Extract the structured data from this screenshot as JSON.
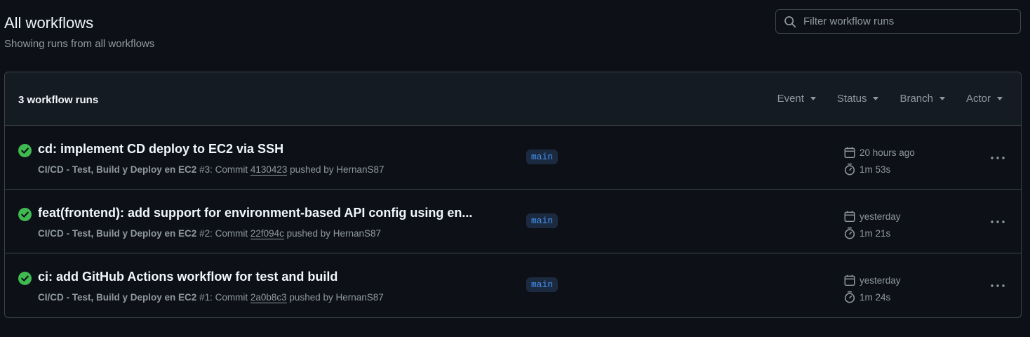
{
  "header": {
    "title": "All workflows",
    "subtitle": "Showing runs from all workflows"
  },
  "search": {
    "placeholder": "Filter workflow runs",
    "value": ""
  },
  "list": {
    "count_label": "3 workflow runs",
    "filters": [
      {
        "label": "Event"
      },
      {
        "label": "Status"
      },
      {
        "label": "Branch"
      },
      {
        "label": "Actor"
      }
    ]
  },
  "runs": [
    {
      "title": "cd: implement CD deploy to EC2 via SSH",
      "workflow": "CI/CD - Test, Build y Deploy en EC2",
      "run_number": "#3",
      "commit_prefix": ": Commit ",
      "sha": "4130423",
      "pushed_by": " pushed by HernanS87",
      "branch": "main",
      "when": "20 hours ago",
      "duration": "1m 53s",
      "status": "success"
    },
    {
      "title": "feat(frontend): add support for environment-based API config using en...",
      "workflow": "CI/CD - Test, Build y Deploy en EC2",
      "run_number": "#2",
      "commit_prefix": ": Commit ",
      "sha": "22f094c",
      "pushed_by": " pushed by HernanS87",
      "branch": "main",
      "when": "yesterday",
      "duration": "1m 21s",
      "status": "success"
    },
    {
      "title": "ci: add GitHub Actions workflow for test and build",
      "workflow": "CI/CD - Test, Build y Deploy en EC2",
      "run_number": "#1",
      "commit_prefix": ": Commit ",
      "sha": "2a0b8c3",
      "pushed_by": " pushed by HernanS87",
      "branch": "main",
      "when": "yesterday",
      "duration": "1m 24s",
      "status": "success"
    }
  ],
  "colors": {
    "background": "#0d1117",
    "header_bg": "#151b23",
    "border": "#3d444d",
    "success": "#3fb950",
    "muted": "#9198a1",
    "branch_text": "#4493f8"
  },
  "icons": {
    "search": "search-icon",
    "success": "check-circle-fill-icon",
    "calendar": "calendar-icon",
    "stopwatch": "stopwatch-icon",
    "more": "kebab-horizontal-icon"
  }
}
